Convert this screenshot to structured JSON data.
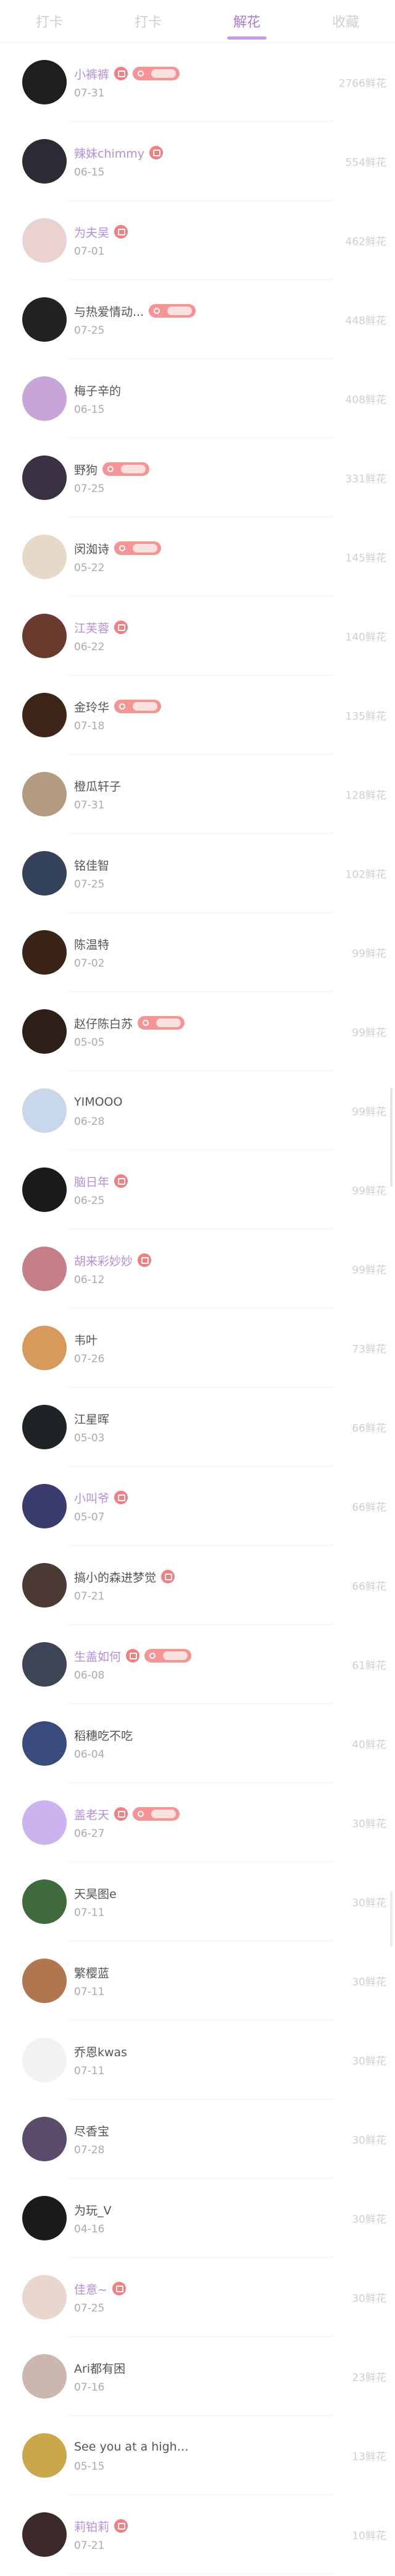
{
  "tabs": [
    "打卡",
    "打卡",
    "解花",
    "收藏"
  ],
  "active_tab_index": 2,
  "list": [
    {
      "name": "小裤裤",
      "date": "07-31",
      "value": "2766鲜花",
      "avatar_color": "#1e1e1e",
      "pink": true,
      "badge": true,
      "level": true
    },
    {
      "name": "辣妹chimmy",
      "date": "06-15",
      "value": "554鲜花",
      "avatar_color": "#2b2b33",
      "pink": true,
      "badge": true,
      "level": false
    },
    {
      "name": "为夫吴",
      "date": "07-01",
      "value": "462鲜花",
      "avatar_color": "#e9d2cf",
      "pink": true,
      "badge": true,
      "level": false
    },
    {
      "name": "与热爱情动...",
      "date": "07-25",
      "value": "448鲜花",
      "avatar_color": "#222222",
      "pink": false,
      "badge": false,
      "level": true
    },
    {
      "name": "梅子辛的",
      "date": "06-15",
      "value": "408鲜花",
      "avatar_color": "#c7a5d8",
      "pink": false,
      "badge": false,
      "level": false
    },
    {
      "name": "野狗",
      "date": "07-25",
      "value": "331鲜花",
      "avatar_color": "#3a3142",
      "pink": false,
      "badge": false,
      "level": true
    },
    {
      "name": "闵洳诗",
      "date": "05-22",
      "value": "145鲜花",
      "avatar_color": "#e7d9c7",
      "pink": false,
      "badge": false,
      "level": true
    },
    {
      "name": "江芙蓉",
      "date": "06-22",
      "value": "140鲜花",
      "avatar_color": "#6a3a2e",
      "pink": true,
      "badge": true,
      "level": false
    },
    {
      "name": "金玲华",
      "date": "07-18",
      "value": "135鲜花",
      "avatar_color": "#3d2618",
      "pink": false,
      "badge": false,
      "level": true
    },
    {
      "name": "橙瓜轩子",
      "date": "07-31",
      "value": "128鲜花",
      "avatar_color": "#b49a80",
      "pink": false,
      "badge": false,
      "level": false
    },
    {
      "name": "铭佳智",
      "date": "07-25",
      "value": "102鲜花",
      "avatar_color": "#34425a",
      "pink": false,
      "badge": false,
      "level": false
    },
    {
      "name": "陈温特",
      "date": "07-02",
      "value": "99鲜花",
      "avatar_color": "#3a2418",
      "pink": false,
      "badge": false,
      "level": false
    },
    {
      "name": "赵仔陈白苏",
      "date": "05-05",
      "value": "99鲜花",
      "avatar_color": "#2e2019",
      "pink": false,
      "badge": false,
      "level": true
    },
    {
      "name": "YIMOOO",
      "date": "06-28",
      "value": "99鲜花",
      "avatar_color": "#c9d7ea",
      "pink": false,
      "badge": false,
      "level": false
    },
    {
      "name": "脑日年",
      "date": "06-25",
      "value": "99鲜花",
      "avatar_color": "#1a1a1a",
      "pink": true,
      "badge": true,
      "level": false
    },
    {
      "name": "胡来彩妙妙",
      "date": "06-12",
      "value": "99鲜花",
      "avatar_color": "#c67f86",
      "pink": true,
      "badge": true,
      "level": false
    },
    {
      "name": "韦叶",
      "date": "07-26",
      "value": "73鲜花",
      "avatar_color": "#d89a5a",
      "pink": false,
      "badge": false,
      "level": false
    },
    {
      "name": "江星晖",
      "date": "05-03",
      "value": "66鲜花",
      "avatar_color": "#1e2326",
      "pink": false,
      "badge": false,
      "level": false
    },
    {
      "name": "小叫爷",
      "date": "05-07",
      "value": "66鲜花",
      "avatar_color": "#3b3c6d",
      "pink": true,
      "badge": true,
      "level": false
    },
    {
      "name": "搞小的森进梦觉",
      "date": "07-21",
      "value": "66鲜花",
      "avatar_color": "#4a3a33",
      "pink": false,
      "badge": true,
      "level": false
    },
    {
      "name": "生盖如何",
      "date": "06-08",
      "value": "61鲜花",
      "avatar_color": "#3d4456",
      "pink": true,
      "badge": true,
      "level": true
    },
    {
      "name": "稻穗吃不吃",
      "date": "06-04",
      "value": "40鲜花",
      "avatar_color": "#384b7a",
      "pink": false,
      "badge": false,
      "level": false
    },
    {
      "name": "盖老天",
      "date": "06-27",
      "value": "30鲜花",
      "avatar_color": "#cbb3ef",
      "pink": true,
      "badge": true,
      "level": true
    },
    {
      "name": "天昊图e",
      "date": "07-11",
      "value": "30鲜花",
      "avatar_color": "#3f6b3c",
      "pink": false,
      "badge": false,
      "level": false
    },
    {
      "name": "繁樱蓝",
      "date": "07-11",
      "value": "30鲜花",
      "avatar_color": "#b07650",
      "pink": false,
      "badge": false,
      "level": false
    },
    {
      "name": "乔恩kwas",
      "date": "07-11",
      "value": "30鲜花",
      "avatar_color": "#f2f2f2",
      "pink": false,
      "badge": false,
      "level": false
    },
    {
      "name": "尽香宝",
      "date": "07-28",
      "value": "30鲜花",
      "avatar_color": "#5a4c6a",
      "pink": false,
      "badge": false,
      "level": false
    },
    {
      "name": "为玩_V",
      "date": "04-16",
      "value": "30鲜花",
      "avatar_color": "#1b1b1b",
      "pink": false,
      "badge": false,
      "level": false
    },
    {
      "name": "佳意~",
      "date": "07-25",
      "value": "30鲜花",
      "avatar_color": "#e8d6cf",
      "pink": true,
      "badge": true,
      "level": false
    },
    {
      "name": "Ari都有困",
      "date": "07-16",
      "value": "23鲜花",
      "avatar_color": "#cbb7b0",
      "pink": false,
      "badge": false,
      "level": false
    },
    {
      "name": "See you at a higher level.",
      "date": "05-15",
      "value": "13鲜花",
      "avatar_color": "#c9a74a",
      "pink": false,
      "badge": false,
      "level": false
    },
    {
      "name": "莉铂莉",
      "date": "07-21",
      "value": "10鲜花",
      "avatar_color": "#3c2a2a",
      "pink": true,
      "badge": true,
      "level": false
    }
  ]
}
